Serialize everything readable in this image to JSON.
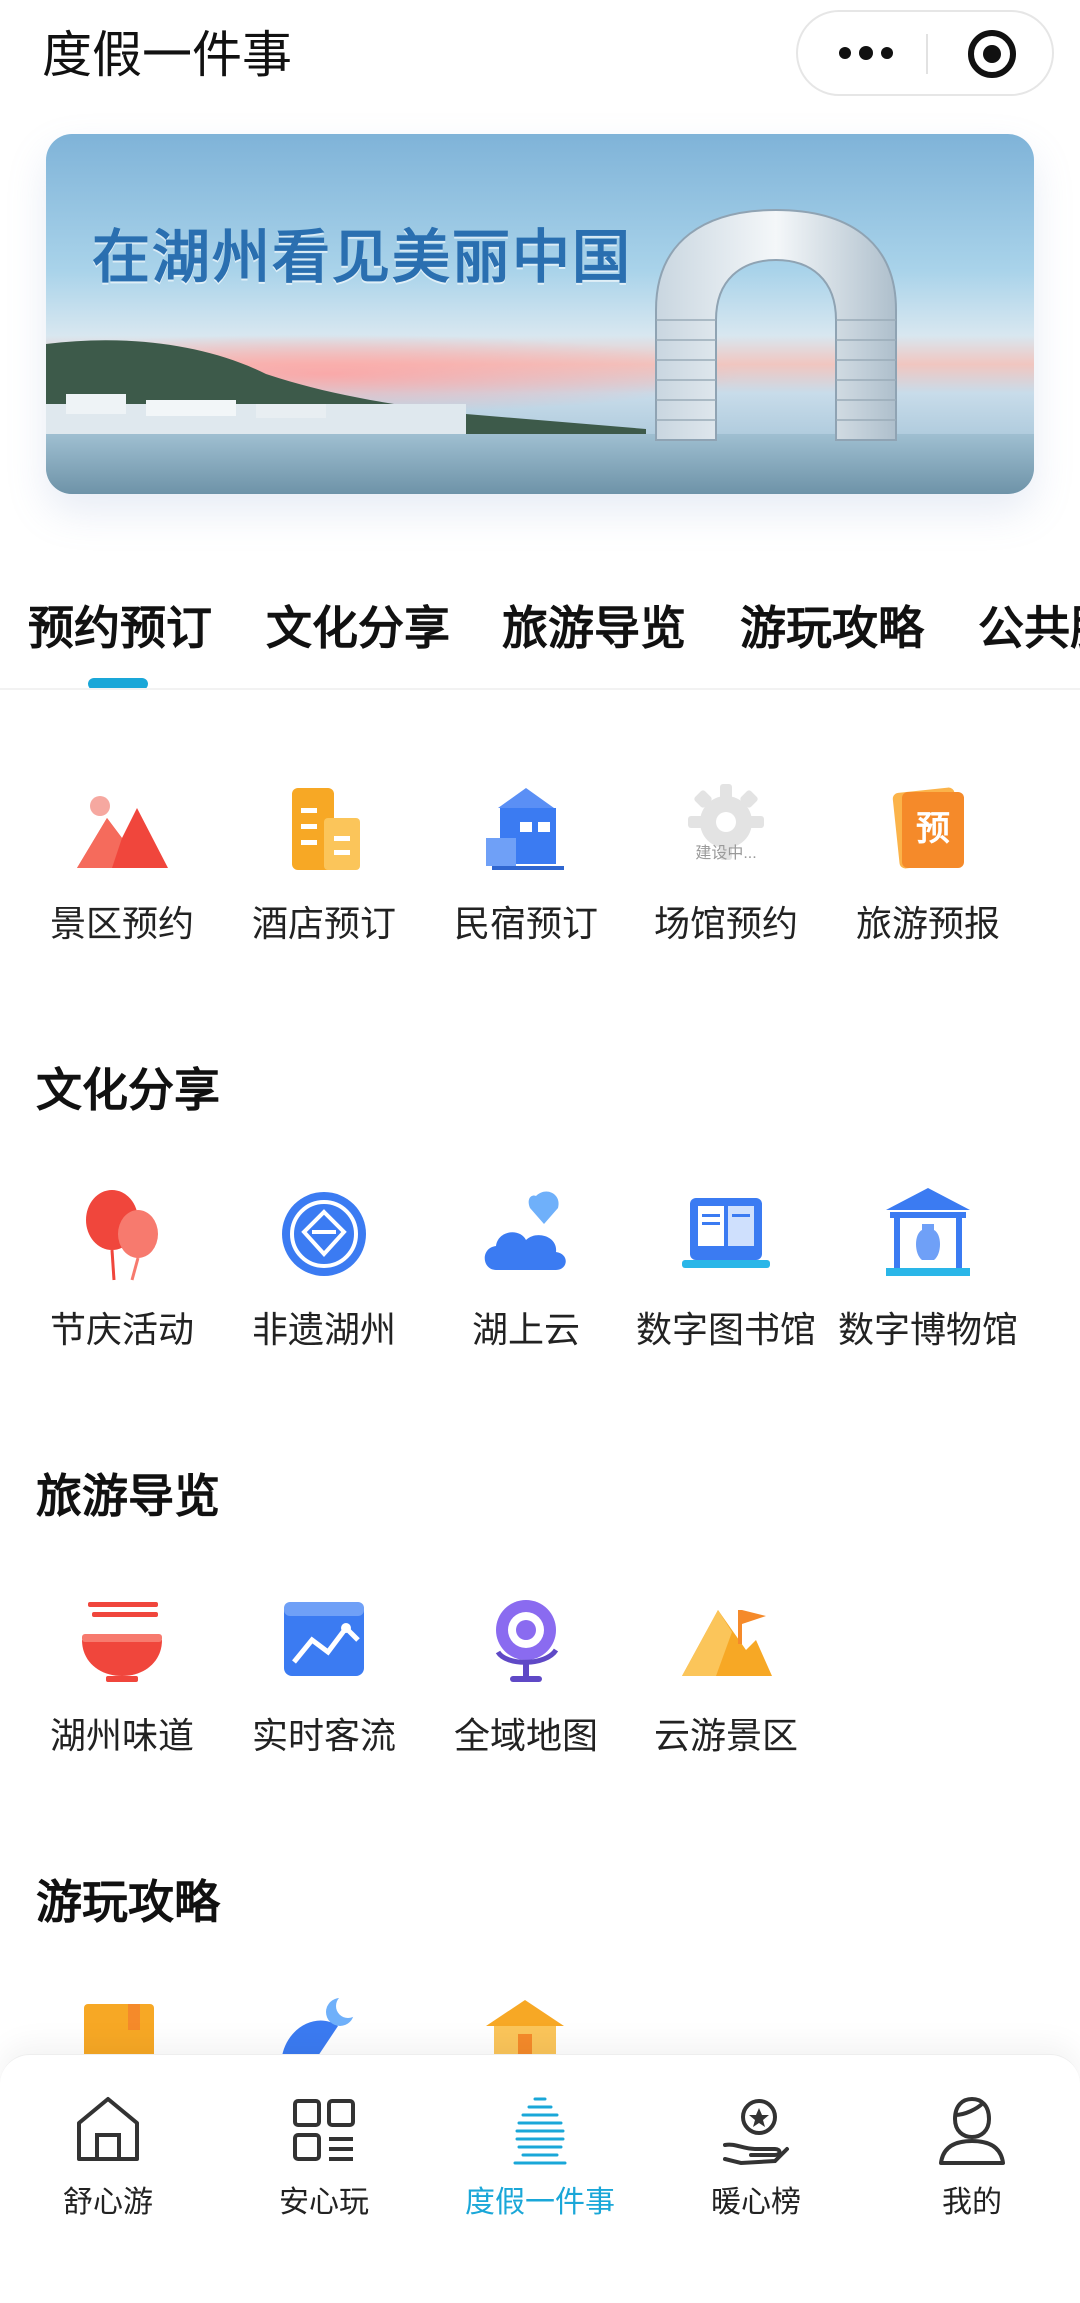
{
  "header": {
    "title": "度假一件事",
    "more_icon": "more-dots-icon",
    "close_icon": "target-icon"
  },
  "banner": {
    "text": "在湖州看见美丽中国"
  },
  "tabs": [
    {
      "label": "预约预订"
    },
    {
      "label": "文化分享"
    },
    {
      "label": "旅游导览"
    },
    {
      "label": "游玩攻略"
    },
    {
      "label": "公共服务"
    }
  ],
  "active_tab_index": 0,
  "sections": {
    "booking": {
      "items": [
        {
          "label": "景区预约",
          "icon": "mountain-icon"
        },
        {
          "label": "酒店预订",
          "icon": "hotel-icon"
        },
        {
          "label": "民宿预订",
          "icon": "house-icon"
        },
        {
          "label": "场馆预约",
          "icon": "gear-icon",
          "icon_caption": "建设中..."
        },
        {
          "label": "旅游预报",
          "icon": "forecast-icon",
          "icon_caption": "预"
        }
      ]
    },
    "culture": {
      "title": "文化分享",
      "items": [
        {
          "label": "节庆活动",
          "icon": "balloon-icon"
        },
        {
          "label": "非遗湖州",
          "icon": "heritage-icon"
        },
        {
          "label": "湖上云",
          "icon": "cloud-heart-icon"
        },
        {
          "label": "数字图书馆",
          "icon": "book-icon"
        },
        {
          "label": "数字博物馆",
          "icon": "museum-icon"
        }
      ]
    },
    "guide": {
      "title": "旅游导览",
      "items": [
        {
          "label": "湖州味道",
          "icon": "noodle-bowl-icon"
        },
        {
          "label": "实时客流",
          "icon": "chart-icon"
        },
        {
          "label": "全域地图",
          "icon": "globe-icon"
        },
        {
          "label": "云游景区",
          "icon": "flag-mountain-icon"
        }
      ]
    },
    "strategy": {
      "title": "游玩攻略"
    }
  },
  "bottom_nav": [
    {
      "label": "舒心游",
      "icon": "home-icon"
    },
    {
      "label": "安心玩",
      "icon": "grid-icon"
    },
    {
      "label": "度假一件事",
      "icon": "vacation-icon"
    },
    {
      "label": "暖心榜",
      "icon": "award-hand-icon"
    },
    {
      "label": "我的",
      "icon": "user-icon"
    }
  ],
  "active_nav_index": 2,
  "colors": {
    "accent": "#1aa7d8",
    "red": "#f0463c",
    "orange": "#f7a825",
    "blue": "#3b7bf2"
  }
}
